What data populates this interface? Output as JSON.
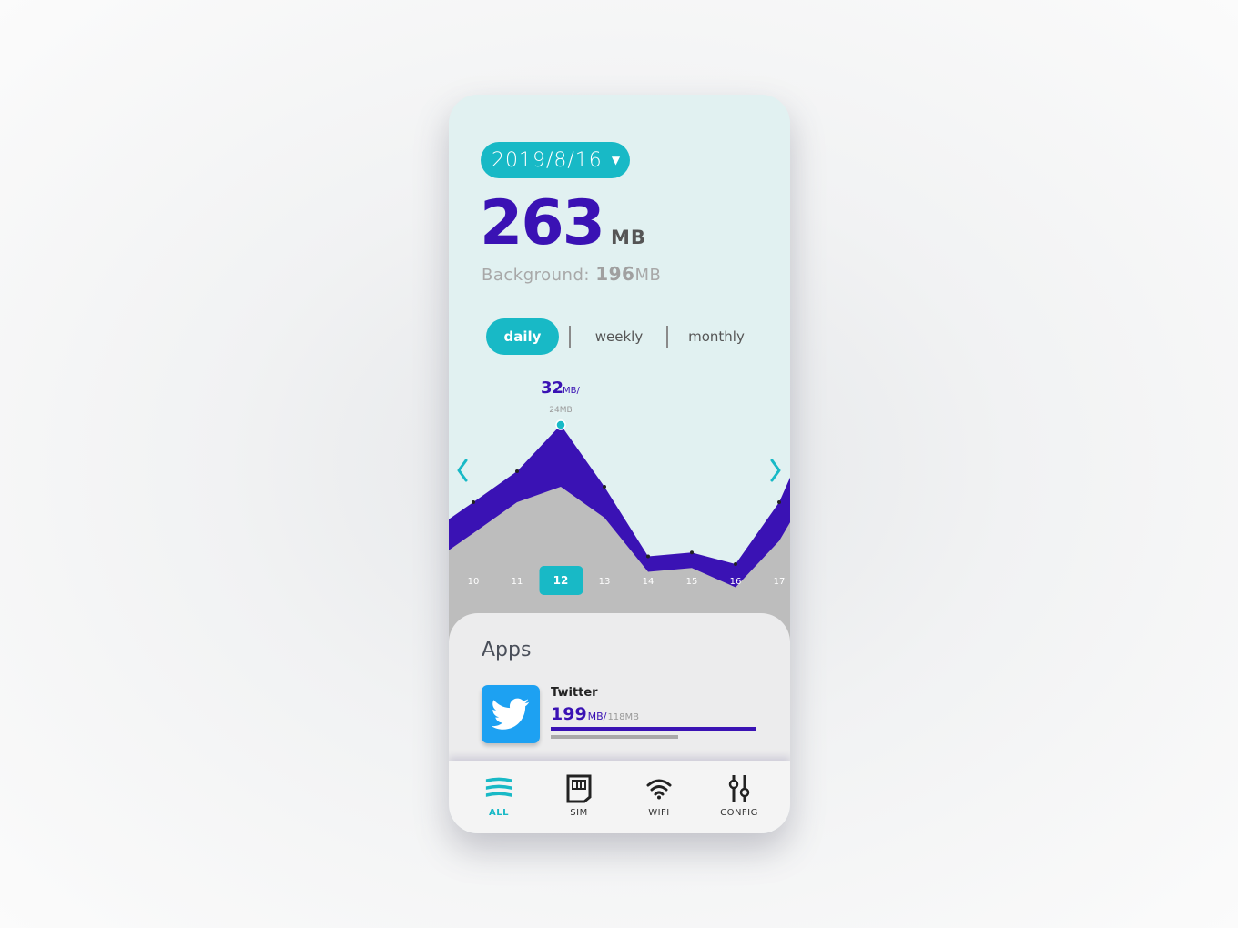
{
  "header": {
    "date": "2019/8/16",
    "total_value": "263",
    "total_unit": "MB",
    "background_label": "Background:",
    "background_value": "196",
    "background_unit": "MB"
  },
  "periods": [
    {
      "label": "daily",
      "active": true
    },
    {
      "label": "weekly",
      "active": false
    },
    {
      "label": "monthly",
      "active": false
    }
  ],
  "chart_data": {
    "type": "area",
    "x": [
      "10",
      "11",
      "12",
      "13",
      "14",
      "15",
      "16",
      "17"
    ],
    "selected": "12",
    "selected_label": {
      "value": "32",
      "unit": "MB/",
      "background": "24MB"
    },
    "series": [
      {
        "values": [
          22,
          26,
          32,
          24,
          15,
          15.5,
          14,
          22
        ],
        "color": "#3a12b4"
      },
      {
        "values": [
          18,
          22,
          24,
          20,
          13,
          13.5,
          11,
          17
        ],
        "color": "#bdbdbd"
      }
    ],
    "ylim": [
      0,
      40
    ]
  },
  "apps": {
    "title": "Apps",
    "items": [
      {
        "name": "Twitter",
        "value": "199",
        "unit": "MB",
        "sep": "/",
        "background": "118MB",
        "usage_fraction": 1.0,
        "background_fraction": 0.62
      }
    ]
  },
  "tabs": [
    {
      "label": "ALL",
      "icon": "layers-icon",
      "active": true
    },
    {
      "label": "SIM",
      "icon": "sim-card-icon",
      "active": false
    },
    {
      "label": "WIFI",
      "icon": "wifi-icon",
      "active": false
    },
    {
      "label": "CONFIG",
      "icon": "sliders-icon",
      "active": false
    }
  ],
  "colors": {
    "accent": "#18b9c6",
    "primary": "#3a12b4",
    "background_series": "#bdbdbd"
  }
}
